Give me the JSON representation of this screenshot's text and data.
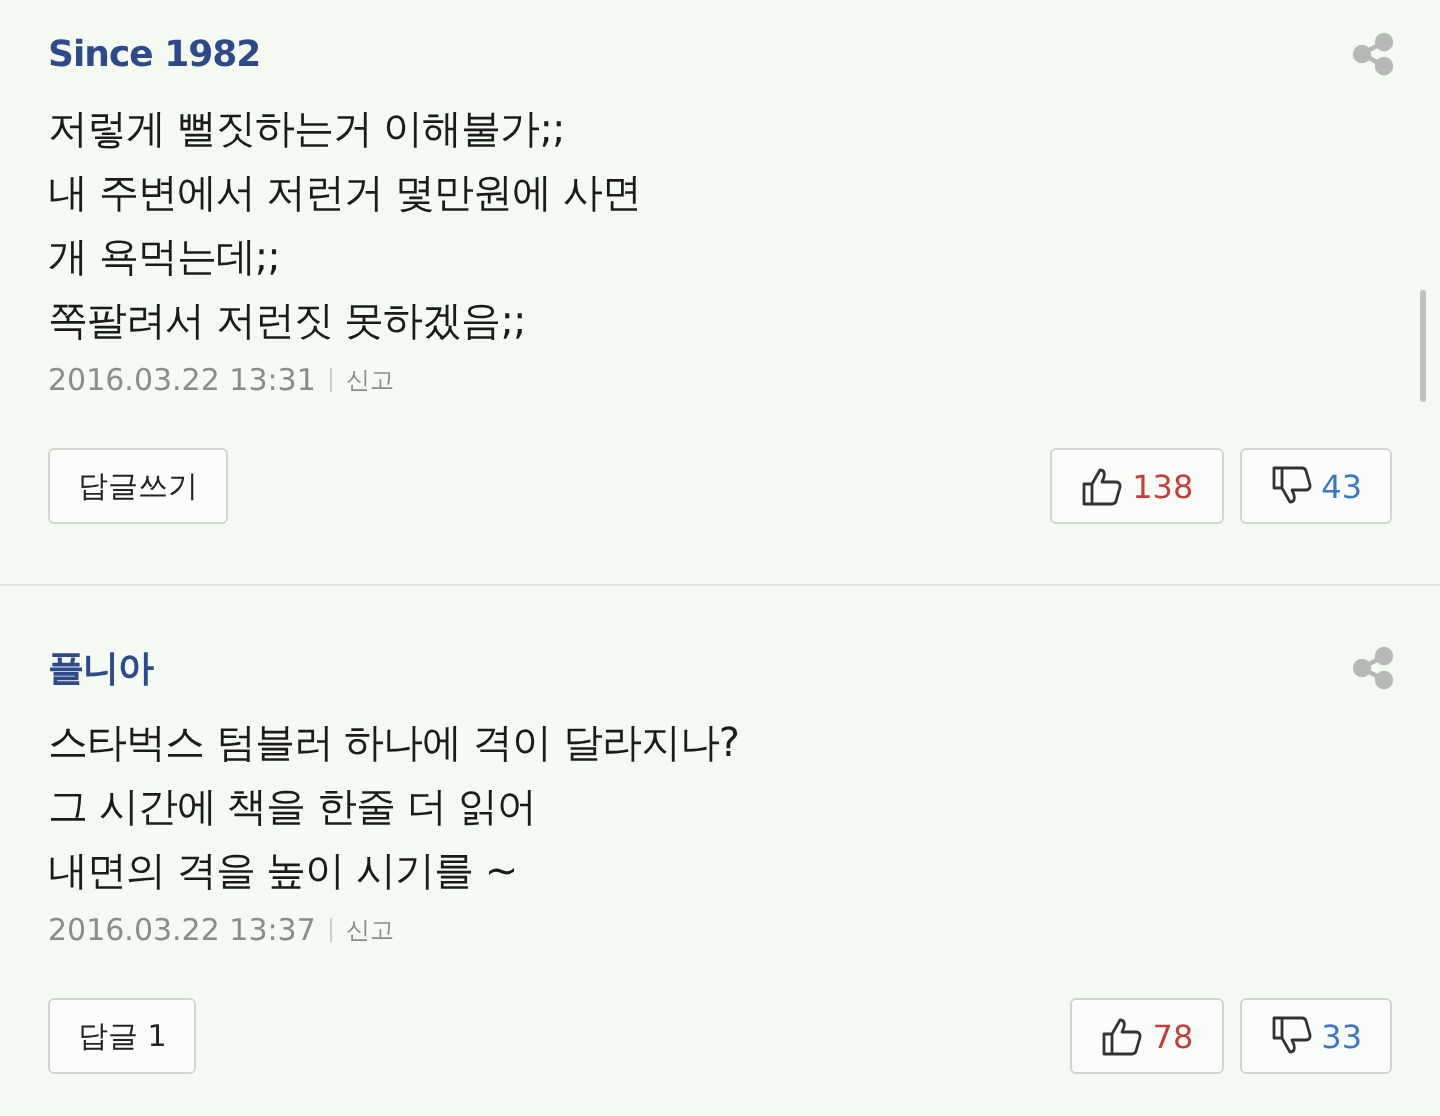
{
  "comments": [
    {
      "author": "Since 1982",
      "body": "저렇게 뻘짓하는거 이해불가;;\n내 주변에서 저런거 몇만원에 사면\n개 욕먹는데;;\n쪽팔려서 저런짓 못하겠음;;",
      "date": "2016.03.22 13:31",
      "report": "신고",
      "reply": "답글쓰기",
      "likes": "138",
      "dislikes": "43"
    },
    {
      "author": "플니아",
      "body": "스타벅스 텀블러 하나에 격이 달라지나?\n그 시간에 책을 한줄 더 읽어\n내면의 격을 높이 시기를 ~",
      "date": "2016.03.22 13:37",
      "report": "신고",
      "reply": "답글 1",
      "likes": "78",
      "dislikes": "33"
    }
  ]
}
